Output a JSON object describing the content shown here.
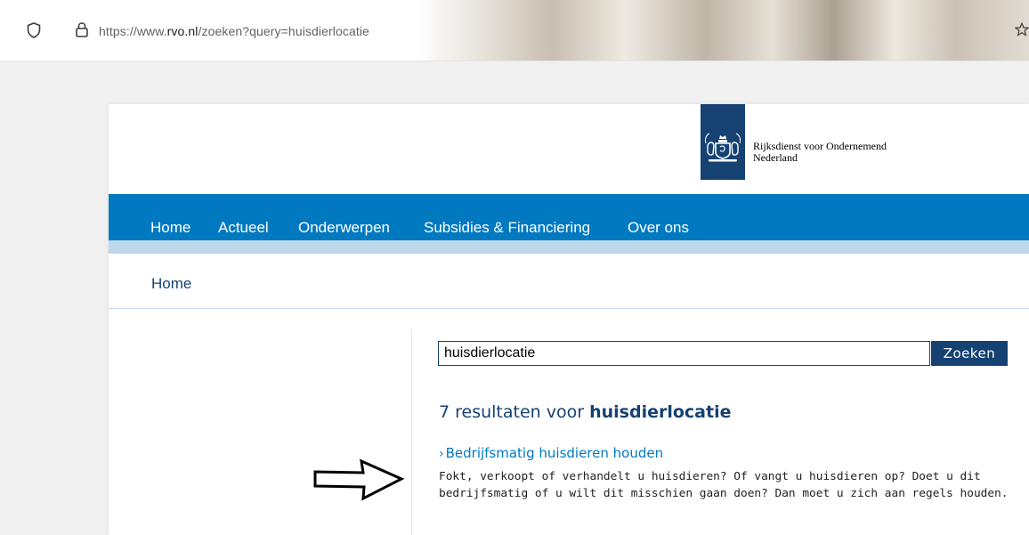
{
  "browser": {
    "url_prefix": "https://www.",
    "url_domain": "rvo.nl",
    "url_path": "/zoeken?query=huisdierlocatie"
  },
  "header": {
    "org_name_line1": "Rijksdienst voor Ondernemend",
    "org_name_line2": "Nederland"
  },
  "nav": {
    "items": [
      {
        "label": "Home"
      },
      {
        "label": "Actueel"
      },
      {
        "label": "Onderwerpen"
      },
      {
        "label": "Subsidies & Financiering"
      },
      {
        "label": "Over ons"
      }
    ]
  },
  "breadcrumb": {
    "home": "Home"
  },
  "search": {
    "value": "huisdierlocatie",
    "button_label": "Zoeken"
  },
  "results": {
    "count_text": "7 resultaten voor",
    "query": "huisdierlocatie",
    "items": [
      {
        "title": "Bedrijfsmatig huisdieren houden",
        "description_line1": "Fokt, verkoopt of verhandelt u huisdieren? Of vangt u huisdieren op? Doet u dit",
        "description_line2": "bedrijfsmatig of u wilt dit misschien gaan doen? Dan moet u zich aan regels houden."
      }
    ]
  },
  "colors": {
    "nav_blue": "#0079c1",
    "dark_blue": "#154273",
    "light_blue": "#bfd9ec"
  },
  "icons": [
    "shield-icon",
    "lock-icon",
    "star-icon",
    "coat-of-arms-logo",
    "chevron-right-icon",
    "arrow-right-icon"
  ]
}
